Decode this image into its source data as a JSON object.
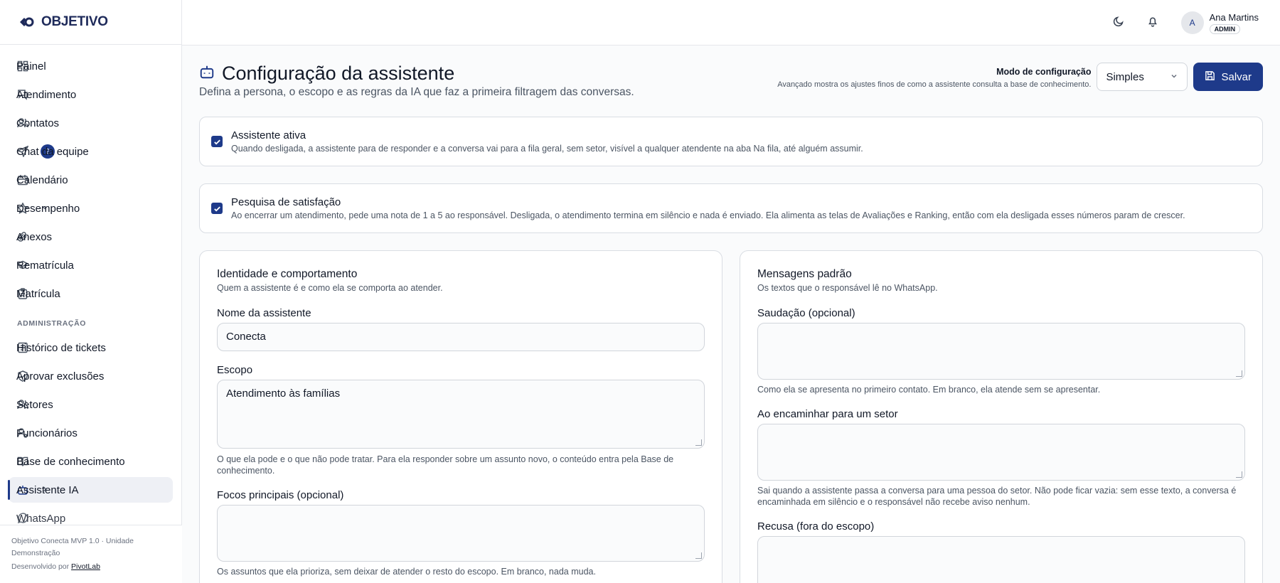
{
  "brand": {
    "name": "OBJETIVO"
  },
  "sidebar": {
    "items": [
      {
        "label": "Painel",
        "icon": "dashboard-icon"
      },
      {
        "label": "Atendimento",
        "icon": "chat-icon"
      },
      {
        "label": "Contatos",
        "icon": "users-icon"
      },
      {
        "label": "Chat da equipe",
        "icon": "send-icon",
        "badge": "2"
      },
      {
        "label": "Calendário",
        "icon": "calendar-icon"
      },
      {
        "label": "Desempenho",
        "icon": "star-icon"
      },
      {
        "label": "Anexos",
        "icon": "paperclip-icon"
      },
      {
        "label": "Rematrícula",
        "icon": "graduation-cap-icon"
      },
      {
        "label": "Matrícula",
        "icon": "clipboard-icon"
      }
    ],
    "section_admin": "ADMINISTRAÇÃO",
    "admin_items": [
      {
        "label": "Histórico de tickets",
        "icon": "ticket-icon"
      },
      {
        "label": "Aprovar exclusões",
        "icon": "shield-check-icon"
      },
      {
        "label": "Setores",
        "icon": "group-icon"
      },
      {
        "label": "Funcionários",
        "icon": "user-cog-icon"
      },
      {
        "label": "Base de conhecimento",
        "icon": "book-icon"
      },
      {
        "label": "Assistente IA",
        "icon": "bot-icon",
        "active": true
      },
      {
        "label": "WhatsApp",
        "icon": "whatsapp-icon"
      }
    ],
    "footer": {
      "line1": "Objetivo Conecta MVP 1.0 · Unidade Demonstração",
      "dev_prefix": "Desenvolvido por ",
      "dev_link": "PivotLab"
    }
  },
  "topbar": {
    "user_initial": "A",
    "user_name": "Ana Martins",
    "user_role": "ADMIN"
  },
  "page": {
    "title": "Configuração da assistente",
    "subtitle": "Defina a persona, o escopo e as regras da IA que faz a primeira filtragem das conversas.",
    "mode_label": "Modo de configuração",
    "mode_hint": "Avançado mostra os ajustes finos de como a assistente consulta a base de conhecimento.",
    "mode_value": "Simples",
    "save_label": "Salvar"
  },
  "toggles": {
    "assistant_title": "Assistente ativa",
    "assistant_desc": "Quando desligada, a assistente para de responder e a conversa vai para a fila geral, sem setor, visível a qualquer atendente na aba Na fila, até alguém assumir.",
    "assistant_checked": true,
    "survey_title": "Pesquisa de satisfação",
    "survey_desc": "Ao encerrar um atendimento, pede uma nota de 1 a 5 ao responsável. Desligada, o atendimento termina em silêncio e nada é enviado. Ela alimenta as telas de Avaliações e Ranking, então com ela desligada esses números param de crescer.",
    "survey_checked": true
  },
  "identity": {
    "title": "Identidade e comportamento",
    "subtitle": "Quem a assistente é e como ela se comporta ao atender.",
    "name_label": "Nome da assistente",
    "name_value": "Conecta",
    "scope_label": "Escopo",
    "scope_value": "Atendimento às famílias",
    "scope_hint": "O que ela pode e o que não pode tratar. Para ela responder sobre um assunto novo, o conteúdo entra pela Base de conhecimento.",
    "focus_label": "Focos principais (opcional)",
    "focus_value": "",
    "focus_hint": "Os assuntos que ela prioriza, sem deixar de atender o resto do escopo. Em branco, nada muda."
  },
  "messages": {
    "title": "Mensagens padrão",
    "subtitle": "Os textos que o responsável lê no WhatsApp.",
    "greeting_label": "Saudação (opcional)",
    "greeting_value": "",
    "greeting_hint": "Como ela se apresenta no primeiro contato. Em branco, ela atende sem se apresentar.",
    "forward_label": "Ao encaminhar para um setor",
    "forward_value": "",
    "forward_hint": "Sai quando a assistente passa a conversa para uma pessoa do setor. Não pode ficar vazia: sem esse texto, a conversa é encaminhada em silêncio e o responsável não recebe aviso nenhum.",
    "refusal_label": "Recusa (fora do escopo)",
    "refusal_value": ""
  }
}
